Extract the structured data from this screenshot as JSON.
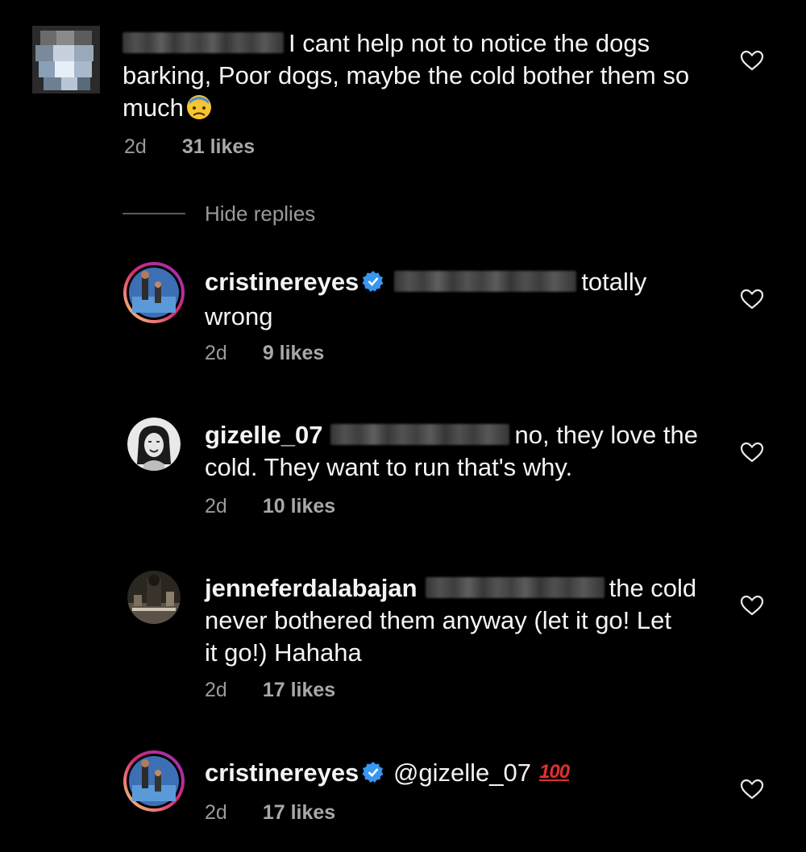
{
  "comments": [
    {
      "username": "",
      "text": "I cant help not to notice the dogs barking, Poor dogs, maybe the cold bother them so much",
      "emoji": "😓",
      "time": "2d",
      "likes": "31 likes"
    },
    {
      "username": "cristinereyes",
      "text_a": "totally",
      "text_b": "wrong",
      "time": "2d",
      "likes": "9 likes"
    },
    {
      "username": "gizelle_07",
      "text_a": "no, they love the",
      "text_b": "cold. They want to run that's why.",
      "time": "2d",
      "likes": "10 likes"
    },
    {
      "username": "jenneferdalabajan",
      "text_a": "the cold",
      "text_b": "never bothered them anyway (let it go! Let",
      "text_c": "it go!) Hahaha",
      "time": "2d",
      "likes": "17 likes"
    },
    {
      "username": "cristinereyes",
      "mention": "@gizelle_07",
      "emoji": "100",
      "time": "2d",
      "likes": "17 likes"
    }
  ],
  "hide_replies_label": "Hide replies",
  "colors": {
    "background": "#000000",
    "text": "#f4f4f4",
    "meta": "#9a9a9a",
    "verified": "#3897f0",
    "story_ring": "#d6249f"
  }
}
